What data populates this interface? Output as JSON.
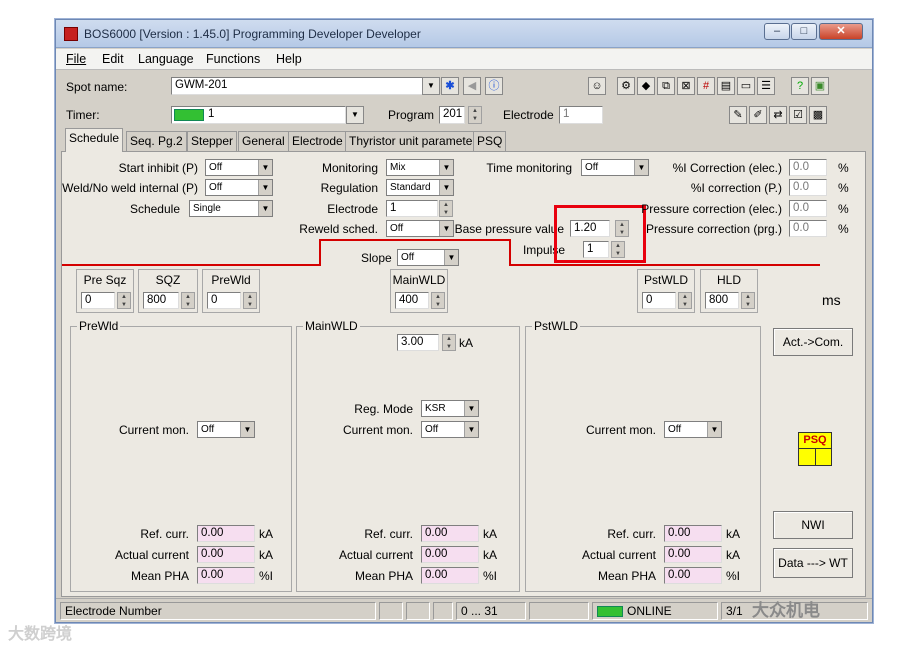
{
  "window": {
    "title": "BOS6000 [Version : 1.45.0] Programming Developer Developer",
    "min": "–",
    "max": "□",
    "close": "✕"
  },
  "menu": [
    "File",
    "Edit",
    "Language",
    "Functions",
    "Help"
  ],
  "spot": {
    "label": "Spot name:",
    "value": "GWM-201"
  },
  "timer": {
    "label": "Timer:",
    "value": "1",
    "program_label": "Program",
    "program_value": "201",
    "electrode_label": "Electrode",
    "electrode_value": "1"
  },
  "tabs": [
    "Schedule",
    "Seq. Pg.2",
    "Stepper",
    "General",
    "Electrode",
    "Thyristor unit parameter",
    "PSQ"
  ],
  "col1": [
    {
      "label": "Start inhibit (P)",
      "value": "Off"
    },
    {
      "label": "Weld/No weld internal (P)",
      "value": "Off"
    },
    {
      "label": "Schedule",
      "value": "Single"
    }
  ],
  "col2": [
    {
      "label": "Monitoring",
      "value": "Mix"
    },
    {
      "label": "Regulation",
      "value": "Standard"
    },
    {
      "label": "Electrode",
      "value": "1"
    },
    {
      "label": "Reweld sched.",
      "value": "Off"
    }
  ],
  "time_monitoring": {
    "label": "Time monitoring",
    "value": "Off"
  },
  "base_pressure": {
    "label": "Base pressure value",
    "value": "1.20"
  },
  "impulse": {
    "label": "Impulse",
    "value": "1"
  },
  "corrections": [
    {
      "label": "%I Correction (elec.)",
      "value": "0.0",
      "unit": "%"
    },
    {
      "label": "%I correction (P.)",
      "value": "0.0",
      "unit": "%"
    },
    {
      "label": "Pressure correction (elec.)",
      "value": "0.0",
      "unit": "%"
    },
    {
      "label": "Pressure correction (prg.)",
      "value": "0.0",
      "unit": "%"
    }
  ],
  "slope": {
    "label": "Slope",
    "value": "Off"
  },
  "times": [
    {
      "label": "Pre Sqz",
      "value": "0"
    },
    {
      "label": "SQZ",
      "value": "800"
    },
    {
      "label": "PreWld",
      "value": "0"
    },
    {
      "label": "MainWLD",
      "value": "400"
    },
    {
      "label": "PstWLD",
      "value": "0"
    },
    {
      "label": "HLD",
      "value": "800"
    }
  ],
  "ms_label": "ms",
  "groups": {
    "prewld": {
      "title": "PreWld",
      "current_mon_label": "Current mon.",
      "current_mon": "Off",
      "ref_curr_label": "Ref. curr.",
      "ref_curr": "0.00",
      "actual_label": "Actual current",
      "actual": "0.00",
      "pha_label": "Mean PHA",
      "pha": "0.00"
    },
    "mainwld": {
      "title": "MainWLD",
      "current": "3.00",
      "current_unit": "kA",
      "reg_mode_label": "Reg. Mode",
      "reg_mode": "KSR",
      "current_mon_label": "Current mon.",
      "current_mon": "Off",
      "ref_curr_label": "Ref. curr.",
      "ref_curr": "0.00",
      "actual_label": "Actual current",
      "actual": "0.00",
      "pha_label": "Mean PHA",
      "pha": "0.00"
    },
    "pstwld": {
      "title": "PstWLD",
      "current_mon_label": "Current mon.",
      "current_mon": "Off",
      "ref_curr_label": "Ref. curr.",
      "ref_curr": "0.00",
      "actual_label": "Actual current",
      "actual": "0.00",
      "pha_label": "Mean PHA",
      "pha": "0.00"
    }
  },
  "units": {
    "ka": "kA",
    "pct": "%I"
  },
  "buttons": {
    "act_com": "Act.->Com.",
    "nwi": "NWI",
    "data_wt": "Data ---> WT"
  },
  "psq_badge": "PSQ",
  "status": {
    "left": "Electrode Number",
    "range": "0 ... 31",
    "online": "ONLINE",
    "right": "3/1"
  },
  "watermarks": {
    "left": "大数跨境",
    "right": "大众机电"
  },
  "colors": {
    "highlight": "#e8000e",
    "slope_line": "#d40000",
    "title": "#1e2d45",
    "psq": "#ffff00"
  }
}
